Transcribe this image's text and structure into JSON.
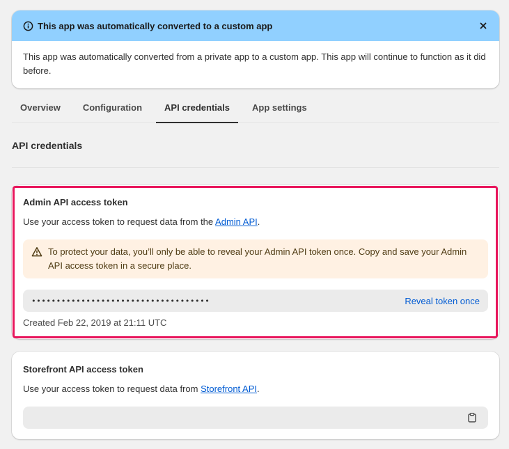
{
  "banner": {
    "title": "This app was automatically converted to a custom app",
    "body": "This app was automatically converted from a private app to a custom app. This app will continue to function as it did before.",
    "info_icon": "info-icon",
    "close_icon": "close-icon"
  },
  "tabs": [
    {
      "label": "Overview"
    },
    {
      "label": "Configuration"
    },
    {
      "label": "API credentials",
      "active": true
    },
    {
      "label": "App settings"
    }
  ],
  "section": {
    "title": "API credentials"
  },
  "admin": {
    "title": "Admin API access token",
    "desc_prefix": "Use your access token to request data from the ",
    "desc_link": "Admin API",
    "desc_suffix": ".",
    "warning": "To protect your data, you’ll only be able to reveal your Admin API token once. Copy and save your Admin API access token in a secure place.",
    "token_mask": "••••••••••••••••••••••••••••••••••••",
    "reveal_label": "Reveal token once",
    "created": "Created Feb 22, 2019 at 21:11 UTC"
  },
  "storefront": {
    "title": "Storefront API access token",
    "desc_prefix": "Use your access token to request data from ",
    "desc_link": "Storefront API",
    "desc_suffix": ".",
    "token_value": "",
    "copy_icon": "clipboard-icon"
  },
  "colors": {
    "banner_bg": "#91d0ff",
    "link": "#005bd3",
    "warning_bg": "#fff1e3",
    "highlight": "#e8175d"
  }
}
